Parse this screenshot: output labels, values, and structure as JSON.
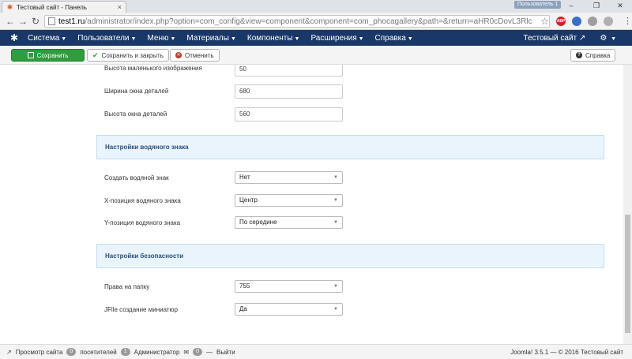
{
  "browser": {
    "tab_title": "Тестовый сайт - Панель",
    "tab_close": "×",
    "user_badge": "Пользователь 1",
    "window_controls": {
      "minimize": "–",
      "maximize": "❐",
      "close": "✕"
    },
    "url_host": "test1.ru",
    "url_path": "/administrator/index.php?option=com_config&view=component&component=com_phocagallery&path=&return=aHR0cDovL3Rlc",
    "extensions": [
      {
        "name": "adblock-icon",
        "label": "ABP",
        "color": "#c8262c"
      },
      {
        "name": "extension-blue-icon",
        "label": "",
        "color": "#3b6fc4"
      },
      {
        "name": "extension-gray-icon",
        "label": "",
        "color": "#9e9e9e"
      },
      {
        "name": "extension-gray2-icon",
        "label": "",
        "color": "#b0b0b0"
      }
    ]
  },
  "navbar": {
    "items": [
      {
        "label": "Система"
      },
      {
        "label": "Пользователи"
      },
      {
        "label": "Меню"
      },
      {
        "label": "Материалы"
      },
      {
        "label": "Компоненты"
      },
      {
        "label": "Расширения"
      },
      {
        "label": "Справка"
      }
    ],
    "site_link": "Тестовый сайт"
  },
  "toolbar": {
    "save": "Сохранить",
    "save_close": "Сохранить и закрыть",
    "cancel": "Отменить",
    "help": "Справка"
  },
  "form": {
    "top_fields": [
      {
        "label": "Высота маленького изображения",
        "value": "50"
      },
      {
        "label": "Ширина окна деталей",
        "value": "680"
      },
      {
        "label": "Высота окна деталей",
        "value": "560"
      }
    ],
    "watermark_section": "Настройки водяного знака",
    "watermark_fields": [
      {
        "label": "Создать водяной знак",
        "value": "Нет"
      },
      {
        "label": "X-позиция водяного знака",
        "value": "Центр"
      },
      {
        "label": "Y-позиция водяного знака",
        "value": "По середине"
      }
    ],
    "security_section": "Настройки безопасности",
    "security_fields": [
      {
        "label": "Права на папку",
        "value": "755"
      },
      {
        "label": "JFile создание миниатюр",
        "value": "Да"
      }
    ]
  },
  "status": {
    "view_site": "Просмотр сайта",
    "visitors_count": "0",
    "visitors_label": "посетителей",
    "admins_count": "1",
    "admins_label": "Администратор",
    "messages_count": "0",
    "logout": "Выйти",
    "version": "Joomla! 3.5.1 — © 2016 Тестовый сайт"
  }
}
